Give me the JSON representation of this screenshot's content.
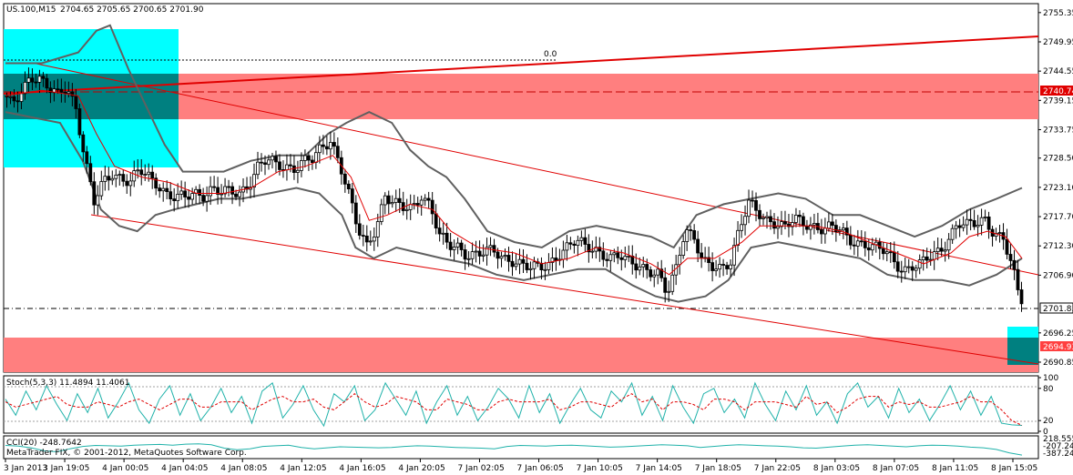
{
  "header": {
    "symbol": "US.100,M15",
    "ohlc": "2704.65 2705.65 2700.65 2701.90"
  },
  "footer": {
    "copyright": "MetaTrader FIX, © 2001-2012, MetaQuotes Software Corp."
  },
  "colors": {
    "background": "#ffffff",
    "candle": "#000000",
    "bollinger": "#606060",
    "ma_fast": "#e00000",
    "trendline": "#e00000",
    "zone_red": "#ff7f7f",
    "zone_cyan": "#00ffff",
    "zone_dark": "#008080",
    "stoch_main": "#20b2aa",
    "stoch_signal": "#e00000",
    "cci": "#20b2aa"
  },
  "chart_data": [
    {
      "type": "candlestick",
      "title": "US.100,M15",
      "ylim": [
        2689.0,
        2757.0
      ],
      "y_ticks": [
        "2755.35",
        "2749.95",
        "2744.55",
        "2739.15",
        "2733.75",
        "2728.50",
        "2723.10",
        "2717.70",
        "2712.30",
        "2706.90",
        "2696.25",
        "2690.85"
      ],
      "x_ticks": [
        "3 Jan 2013",
        "3 Jan 19:05",
        "4 Jan 00:05",
        "4 Jan 04:05",
        "4 Jan 08:05",
        "4 Jan 12:05",
        "4 Jan 16:05",
        "4 Jan 20:05",
        "7 Jan 02:05",
        "7 Jan 06:05",
        "7 Jan 10:05",
        "7 Jan 14:05",
        "7 Jan 18:05",
        "7 Jan 22:05",
        "8 Jan 03:05",
        "8 Jan 07:05",
        "8 Jan 11:05",
        "8 Jan 15:05"
      ],
      "price_tags": {
        "current": "2701.85",
        "upper_zone": "2740.74",
        "lower_zone": "2694.93"
      },
      "level_label": "0.0",
      "close_path": [
        [
          0,
          2740
        ],
        [
          10,
          2738
        ],
        [
          20,
          2741
        ],
        [
          30,
          2744
        ],
        [
          40,
          2743
        ],
        [
          50,
          2741
        ],
        [
          60,
          2740
        ],
        [
          70,
          2742
        ],
        [
          80,
          2738
        ],
        [
          90,
          2728
        ],
        [
          100,
          2720
        ],
        [
          110,
          2724
        ],
        [
          120,
          2726
        ],
        [
          130,
          2725
        ],
        [
          140,
          2724
        ],
        [
          150,
          2726
        ],
        [
          160,
          2725
        ],
        [
          170,
          2724
        ],
        [
          180,
          2722
        ],
        [
          190,
          2721
        ],
        [
          200,
          2721
        ],
        [
          210,
          2722
        ],
        [
          220,
          2722
        ],
        [
          230,
          2723
        ],
        [
          240,
          2722
        ],
        [
          250,
          2722
        ],
        [
          260,
          2722
        ],
        [
          270,
          2724
        ],
        [
          280,
          2727
        ],
        [
          290,
          2728
        ],
        [
          300,
          2727
        ],
        [
          310,
          2727
        ],
        [
          320,
          2727
        ],
        [
          330,
          2728
        ],
        [
          340,
          2728
        ],
        [
          350,
          2730
        ],
        [
          360,
          2732
        ],
        [
          370,
          2728
        ],
        [
          380,
          2722
        ],
        [
          390,
          2715
        ],
        [
          400,
          2712
        ],
        [
          410,
          2716
        ],
        [
          420,
          2722
        ],
        [
          430,
          2720
        ],
        [
          440,
          2719
        ],
        [
          450,
          2719
        ],
        [
          460,
          2722
        ],
        [
          470,
          2720
        ],
        [
          480,
          2714
        ],
        [
          490,
          2712
        ],
        [
          500,
          2712
        ],
        [
          510,
          2711
        ],
        [
          520,
          2711
        ],
        [
          530,
          2711
        ],
        [
          540,
          2711
        ],
        [
          550,
          2710
        ],
        [
          560,
          2710
        ],
        [
          570,
          2709
        ],
        [
          580,
          2708
        ],
        [
          590,
          2708
        ],
        [
          600,
          2709
        ],
        [
          610,
          2711
        ],
        [
          620,
          2712
        ],
        [
          630,
          2713
        ],
        [
          640,
          2712
        ],
        [
          650,
          2712
        ],
        [
          660,
          2711
        ],
        [
          670,
          2710
        ],
        [
          680,
          2710
        ],
        [
          690,
          2709
        ],
        [
          700,
          2709
        ],
        [
          710,
          2708
        ],
        [
          720,
          2707
        ],
        [
          730,
          2703
        ],
        [
          740,
          2708
        ],
        [
          750,
          2716
        ],
        [
          760,
          2714
        ],
        [
          770,
          2709
        ],
        [
          780,
          2708
        ],
        [
          790,
          2708
        ],
        [
          800,
          2710
        ],
        [
          810,
          2716
        ],
        [
          820,
          2720
        ],
        [
          830,
          2718
        ],
        [
          840,
          2717
        ],
        [
          850,
          2717
        ],
        [
          860,
          2716
        ],
        [
          870,
          2717
        ],
        [
          880,
          2716
        ],
        [
          890,
          2716
        ],
        [
          900,
          2716
        ],
        [
          910,
          2716
        ],
        [
          920,
          2715
        ],
        [
          930,
          2713
        ],
        [
          940,
          2713
        ],
        [
          950,
          2713
        ],
        [
          960,
          2712
        ],
        [
          970,
          2711
        ],
        [
          980,
          2709
        ],
        [
          990,
          2708
        ],
        [
          1000,
          2709
        ],
        [
          1010,
          2709
        ],
        [
          1020,
          2710
        ],
        [
          1030,
          2711
        ],
        [
          1040,
          2714
        ],
        [
          1050,
          2717
        ],
        [
          1060,
          2716
        ],
        [
          1070,
          2716
        ],
        [
          1080,
          2717
        ],
        [
          1090,
          2715
        ],
        [
          1100,
          2714
        ],
        [
          1110,
          2708
        ],
        [
          1118,
          2702
        ]
      ],
      "bollinger_upper_path": [
        [
          0,
          2746
        ],
        [
          40,
          2746
        ],
        [
          80,
          2748
        ],
        [
          100,
          2752
        ],
        [
          115,
          2753
        ],
        [
          135,
          2745
        ],
        [
          155,
          2738
        ],
        [
          175,
          2731
        ],
        [
          195,
          2726
        ],
        [
          215,
          2726
        ],
        [
          240,
          2726
        ],
        [
          270,
          2728
        ],
        [
          300,
          2729
        ],
        [
          330,
          2729
        ],
        [
          355,
          2733
        ],
        [
          375,
          2735
        ],
        [
          400,
          2737
        ],
        [
          425,
          2735
        ],
        [
          445,
          2730
        ],
        [
          465,
          2727
        ],
        [
          485,
          2725
        ],
        [
          505,
          2721
        ],
        [
          530,
          2715
        ],
        [
          560,
          2713
        ],
        [
          590,
          2712
        ],
        [
          620,
          2715
        ],
        [
          650,
          2716
        ],
        [
          680,
          2715
        ],
        [
          710,
          2714
        ],
        [
          735,
          2712
        ],
        [
          760,
          2718
        ],
        [
          790,
          2720
        ],
        [
          820,
          2721
        ],
        [
          850,
          2722
        ],
        [
          880,
          2721
        ],
        [
          910,
          2718
        ],
        [
          940,
          2718
        ],
        [
          970,
          2716
        ],
        [
          1000,
          2714
        ],
        [
          1030,
          2716
        ],
        [
          1060,
          2719
        ],
        [
          1090,
          2721
        ],
        [
          1118,
          2723
        ]
      ],
      "bollinger_lower_path": [
        [
          0,
          2737
        ],
        [
          30,
          2736
        ],
        [
          60,
          2735
        ],
        [
          85,
          2728
        ],
        [
          105,
          2719
        ],
        [
          125,
          2716
        ],
        [
          145,
          2715
        ],
        [
          165,
          2718
        ],
        [
          185,
          2719
        ],
        [
          210,
          2720
        ],
        [
          235,
          2721
        ],
        [
          260,
          2721
        ],
        [
          290,
          2722
        ],
        [
          320,
          2723
        ],
        [
          345,
          2722
        ],
        [
          370,
          2718
        ],
        [
          385,
          2712
        ],
        [
          405,
          2710
        ],
        [
          430,
          2712
        ],
        [
          455,
          2711
        ],
        [
          480,
          2710
        ],
        [
          510,
          2709
        ],
        [
          540,
          2707
        ],
        [
          570,
          2706
        ],
        [
          600,
          2707
        ],
        [
          630,
          2708
        ],
        [
          660,
          2708
        ],
        [
          690,
          2705
        ],
        [
          715,
          2703
        ],
        [
          740,
          2702
        ],
        [
          770,
          2703
        ],
        [
          795,
          2706
        ],
        [
          820,
          2712
        ],
        [
          850,
          2713
        ],
        [
          880,
          2712
        ],
        [
          910,
          2711
        ],
        [
          940,
          2710
        ],
        [
          970,
          2707
        ],
        [
          1000,
          2706
        ],
        [
          1030,
          2706
        ],
        [
          1060,
          2705
        ],
        [
          1090,
          2707
        ],
        [
          1118,
          2710
        ]
      ],
      "ma_path": [
        [
          0,
          2740
        ],
        [
          40,
          2741
        ],
        [
          80,
          2740
        ],
        [
          100,
          2733
        ],
        [
          120,
          2727
        ],
        [
          150,
          2725
        ],
        [
          180,
          2724
        ],
        [
          210,
          2722
        ],
        [
          240,
          2722
        ],
        [
          270,
          2723
        ],
        [
          300,
          2726
        ],
        [
          330,
          2727
        ],
        [
          360,
          2729
        ],
        [
          380,
          2725
        ],
        [
          400,
          2717
        ],
        [
          420,
          2718
        ],
        [
          445,
          2720
        ],
        [
          470,
          2719
        ],
        [
          490,
          2715
        ],
        [
          520,
          2712
        ],
        [
          560,
          2711
        ],
        [
          590,
          2709
        ],
        [
          620,
          2710
        ],
        [
          650,
          2712
        ],
        [
          680,
          2711
        ],
        [
          710,
          2709
        ],
        [
          730,
          2707
        ],
        [
          750,
          2710
        ],
        [
          780,
          2710
        ],
        [
          810,
          2713
        ],
        [
          830,
          2716
        ],
        [
          860,
          2716
        ],
        [
          890,
          2716
        ],
        [
          920,
          2715
        ],
        [
          950,
          2713
        ],
        [
          980,
          2711
        ],
        [
          1010,
          2709
        ],
        [
          1040,
          2711
        ],
        [
          1060,
          2714
        ],
        [
          1080,
          2715
        ],
        [
          1100,
          2714
        ],
        [
          1118,
          2710
        ]
      ]
    },
    {
      "type": "line",
      "title": "Stoch(5,3,3) 11.4894 11.4061",
      "ylim": [
        0,
        100
      ],
      "y_ticks": [
        "100",
        "80",
        "20",
        "0"
      ],
      "series": [
        {
          "name": "Stoch main",
          "values": [
            60,
            30,
            75,
            40,
            85,
            50,
            20,
            70,
            35,
            80,
            25,
            55,
            90,
            40,
            15,
            60,
            85,
            30,
            70,
            20,
            45,
            80,
            35,
            65,
            15,
            75,
            90,
            25,
            50,
            85,
            40,
            10,
            70,
            55,
            85,
            20,
            40,
            90,
            60,
            30,
            75,
            15,
            55,
            85,
            30,
            65,
            20,
            45,
            80,
            60,
            25,
            85,
            35,
            70,
            15,
            50,
            80,
            40,
            25,
            75,
            55,
            90,
            30,
            65,
            20,
            85,
            45,
            15,
            70,
            80,
            35,
            60,
            25,
            90,
            50,
            20,
            75,
            40,
            85,
            30,
            55,
            15,
            70,
            90,
            45,
            65,
            25,
            80,
            35,
            60,
            20,
            50,
            85,
            40,
            75,
            30,
            65,
            15,
            12,
            11
          ]
        },
        {
          "name": "Stoch signal",
          "values": [
            55,
            45,
            50,
            55,
            60,
            65,
            50,
            45,
            45,
            55,
            50,
            45,
            55,
            60,
            50,
            40,
            50,
            60,
            60,
            45,
            45,
            55,
            55,
            55,
            40,
            50,
            60,
            65,
            55,
            55,
            60,
            45,
            40,
            55,
            70,
            55,
            45,
            50,
            65,
            60,
            55,
            40,
            40,
            60,
            55,
            50,
            40,
            40,
            55,
            60,
            55,
            55,
            55,
            60,
            40,
            45,
            55,
            55,
            50,
            45,
            60,
            70,
            55,
            60,
            40,
            55,
            55,
            50,
            40,
            60,
            60,
            55,
            40,
            55,
            55,
            55,
            50,
            45,
            65,
            50,
            55,
            35,
            45,
            60,
            65,
            65,
            45,
            55,
            50,
            55,
            45,
            45,
            50,
            55,
            65,
            55,
            55,
            40,
            20,
            11
          ]
        }
      ]
    },
    {
      "type": "line",
      "title": "CCI(20) -248.7642",
      "y_ticks": [
        "218.555",
        "-207.2486",
        "-387.2486"
      ],
      "series": [
        {
          "name": "CCI(20)",
          "values": [
            40,
            20,
            -30,
            -120,
            -150,
            -60,
            10,
            40,
            30,
            20,
            50,
            60,
            70,
            50,
            80,
            90,
            60,
            -40,
            -90,
            -60,
            10,
            30,
            50,
            -20,
            -60,
            -30,
            0,
            -10,
            -20,
            -30,
            -20,
            10,
            30,
            20,
            0,
            -20,
            -30,
            -40,
            -60,
            10,
            40,
            30,
            20,
            40,
            50,
            30,
            10,
            -10,
            0,
            20,
            40,
            60,
            50,
            30,
            -20,
            10,
            40,
            60,
            50,
            30,
            20,
            0,
            -30,
            -40,
            -10,
            20,
            50,
            60,
            40,
            20,
            0,
            30,
            50,
            40,
            20,
            -10,
            -30,
            -80,
            -180,
            -249
          ]
        }
      ]
    }
  ]
}
